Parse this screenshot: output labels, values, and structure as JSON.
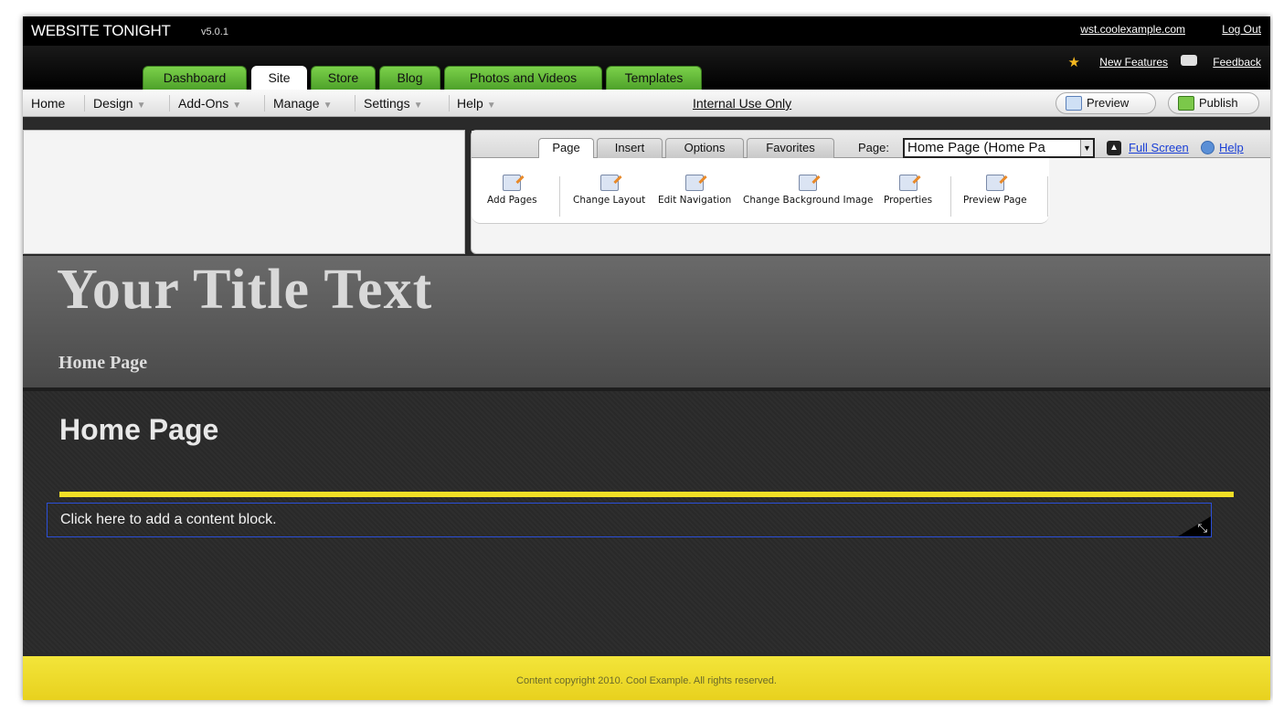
{
  "topbar": {
    "brand": "WEBSITE TONIGHT",
    "version": "v5.0.1",
    "site_link": "wst.coolexample.com",
    "logout": "Log Out"
  },
  "tabs": {
    "dashboard": "Dashboard",
    "site": "Site",
    "store": "Store",
    "blog": "Blog",
    "photos": "Photos and Videos",
    "templates": "Templates",
    "active": "Site"
  },
  "right_links": {
    "new_features": "New Features",
    "feedback": "Feedback"
  },
  "menu": {
    "home": "Home",
    "design": "Design",
    "addons": "Add-Ons",
    "manage": "Manage",
    "settings": "Settings",
    "help": "Help",
    "internal": "Internal Use Only",
    "preview": "Preview",
    "publish": "Publish"
  },
  "ribbon": {
    "tabs": {
      "page": "Page",
      "insert": "Insert",
      "options": "Options",
      "favorites": "Favorites",
      "active": "Page"
    },
    "page_label": "Page:",
    "page_select_value": "Home Page (Home Pa",
    "full_screen": "Full Screen",
    "help": "Help",
    "tools": {
      "add_pages": "Add Pages",
      "change_layout": "Change Layout",
      "edit_navigation": "Edit Navigation",
      "change_background": "Change Background Image",
      "properties": "Properties",
      "preview_page": "Preview Page"
    }
  },
  "site": {
    "title": "Your Title Text",
    "nav_item": "Home Page",
    "page_heading": "Home Page",
    "content_block_prompt": "Click here to add a content block.",
    "footer": "Content copyright 2010. Cool Example. All rights reserved."
  },
  "colors": {
    "tab_green": "#5fb535",
    "footer_yellow": "#f0df2c",
    "accent_line": "#f2df26",
    "link_blue": "#1a3fd6"
  }
}
